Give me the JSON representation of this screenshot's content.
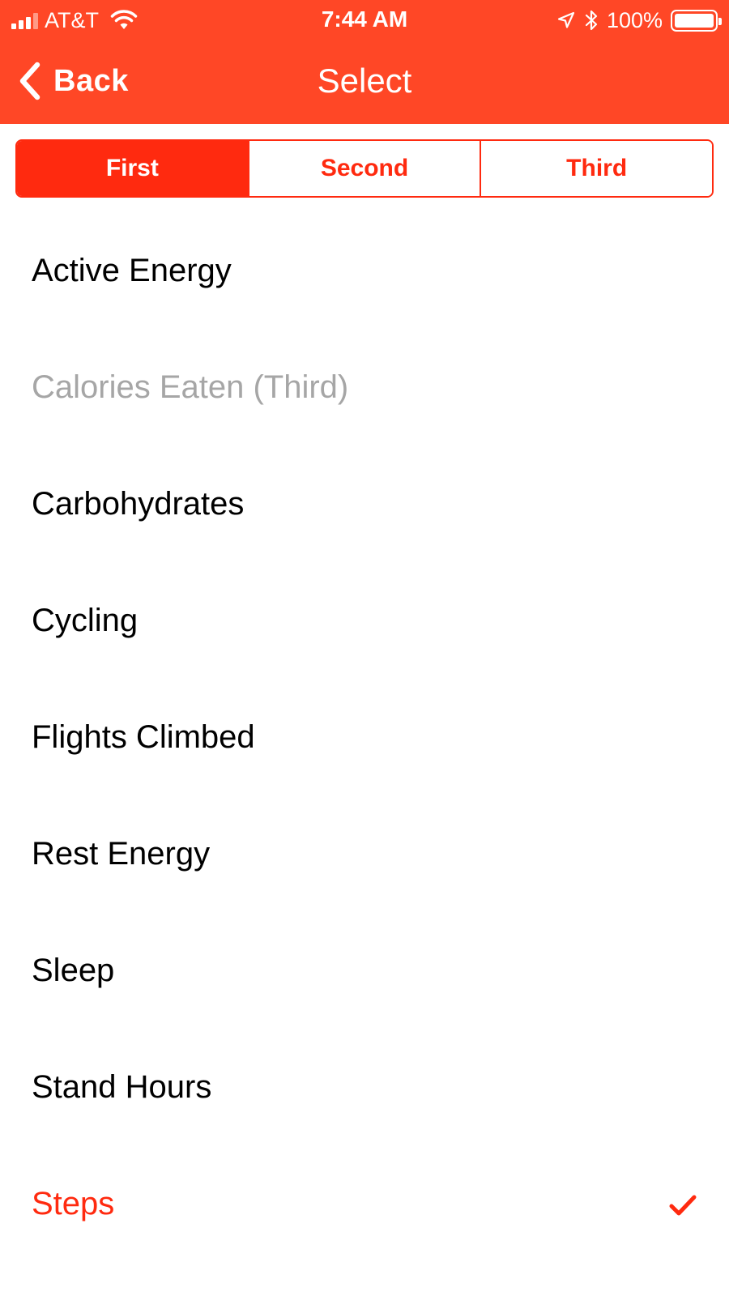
{
  "colors": {
    "header_background": "#FF4726",
    "accent": "#FF2A0F",
    "text": "#000000",
    "disabled_text": "#A6A6A6",
    "background": "#FFFFFF"
  },
  "status_bar": {
    "carrier": "AT&T",
    "time": "7:44 AM",
    "battery_percent": "100%",
    "icons": [
      "signal-icon",
      "wifi-icon",
      "location-icon",
      "bluetooth-icon",
      "battery-icon"
    ]
  },
  "nav": {
    "back_label": "Back",
    "back_icon": "chevron-left-icon",
    "title": "Select"
  },
  "segments": [
    {
      "label": "First",
      "selected": true
    },
    {
      "label": "Second",
      "selected": false
    },
    {
      "label": "Third",
      "selected": false
    }
  ],
  "items": [
    {
      "label": "Active Energy",
      "state": "normal"
    },
    {
      "label": "Calories Eaten (Third)",
      "state": "disabled"
    },
    {
      "label": "Carbohydrates",
      "state": "normal"
    },
    {
      "label": "Cycling",
      "state": "normal"
    },
    {
      "label": "Flights Climbed",
      "state": "normal"
    },
    {
      "label": "Rest Energy",
      "state": "normal"
    },
    {
      "label": "Sleep",
      "state": "normal"
    },
    {
      "label": "Stand Hours",
      "state": "normal"
    },
    {
      "label": "Steps",
      "state": "checked",
      "icon": "checkmark-icon"
    }
  ]
}
